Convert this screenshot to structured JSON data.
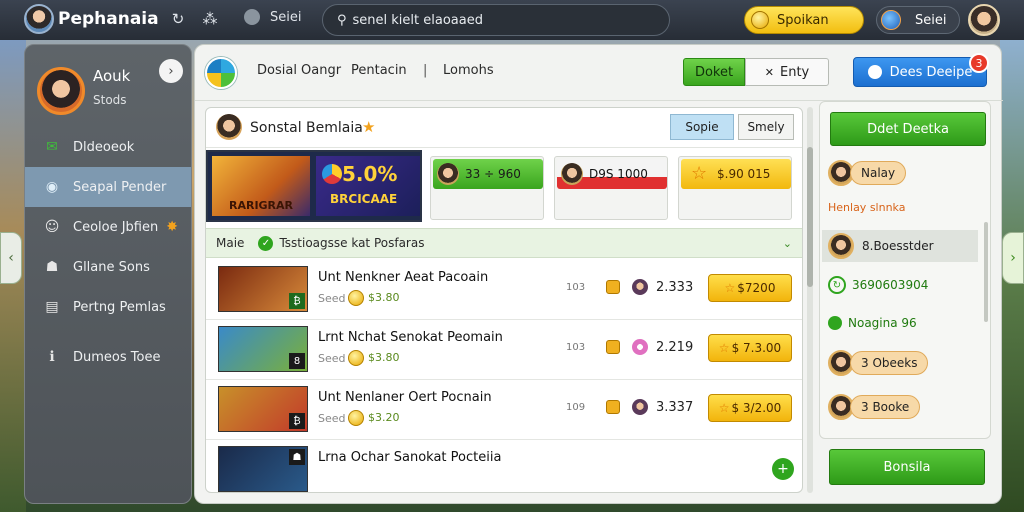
{
  "topbar": {
    "app_title": "Pephanaia",
    "icon_1": "↻",
    "icon_2": "⁂",
    "menu_label": "Seiei",
    "search_text": "senel kielt elaoaaed",
    "coins_label": "Spoikan",
    "region_label": "Seiei"
  },
  "sidebar": {
    "user_name": "Aouk",
    "user_status": "Stods",
    "collapse_icon": "›",
    "items": [
      {
        "label": "Dldeoeok",
        "icon": "envelope-icon",
        "glyph": "✉",
        "color": "#3fbf3a"
      },
      {
        "label": "Seapal Pender",
        "icon": "chat-icon",
        "glyph": "◉",
        "color": "#9ec8e8"
      },
      {
        "label": "Ceoloe Jbfien",
        "icon": "people-icon",
        "glyph": "👥",
        "badge": "✸"
      },
      {
        "label": "Gllane Sons",
        "icon": "group-icon",
        "glyph": "☗"
      },
      {
        "label": "Pertng Pemlas",
        "icon": "document-icon",
        "glyph": "▤"
      },
      {
        "label": "Dumeos Toee",
        "icon": "info-icon",
        "glyph": "ℹ"
      }
    ]
  },
  "main_header": {
    "link_1": "Dosial Oangr",
    "link_2": "Pentacin",
    "separator": "|",
    "link_3": "Lomohs",
    "tab_green": "Doket",
    "tab_white": "Enty",
    "tab_white_icon": "✕",
    "blue_button": "Dees Deeipe",
    "notification_count": "3"
  },
  "card": {
    "title": "Sonstal Bemlaia",
    "title_star": "★",
    "chip_1": "Sopie",
    "chip_2": "Smely",
    "banner": {
      "game_label": "RARIGRAR",
      "promo_value": "5.0%",
      "promo_label": "BRCICAAE"
    },
    "stats": [
      {
        "value": "33 ÷ 960",
        "style": "green"
      },
      {
        "value": "D9S 1000",
        "style": "red"
      },
      {
        "value": "$.90 015",
        "style": "yellow"
      }
    ],
    "filter": {
      "label": "Maie",
      "text": "Tsstioagsse kat Posfaras",
      "chevron": "⌄"
    },
    "offers": [
      {
        "title": "Unt Nenkner Aeat Pacoain",
        "sub": "Seed",
        "points": "$3.80",
        "num": "103",
        "count": "2.333",
        "price": "$7200",
        "badge": "₿",
        "thumb_colors": [
          "#7a2a10",
          "#d88a3a"
        ]
      },
      {
        "title": "Lrnt Nchat Senokat Peomain",
        "sub": "Seed",
        "points": "$3.80",
        "num": "103",
        "count": "2.219",
        "price": "$ 7.3.00",
        "badge": "8",
        "thumb_colors": [
          "#3a8ac8",
          "#7ab03a"
        ]
      },
      {
        "title": "Unt Nenlaner Oert Pocnain",
        "sub": "Seed",
        "points": "$3.20",
        "num": "109",
        "count": "3.337",
        "price": "$ 3/2.00",
        "badge": "₿",
        "thumb_colors": [
          "#c8902a",
          "#c23a2a"
        ]
      },
      {
        "title": "Lrna Ochar Sanokat Pocteiia",
        "sub": "",
        "points": "",
        "num": "",
        "count": "",
        "price": "",
        "badge": "☗",
        "thumb_colors": [
          "#1a2a4a",
          "#2a5a8a"
        ]
      }
    ]
  },
  "right_panel": {
    "top_button": "Ddet Deetka",
    "items": [
      {
        "label": "Nalay",
        "type": "pill-face"
      },
      {
        "label": "Henlay slnnka",
        "type": "orange-text"
      },
      {
        "label": "8.Boesstder",
        "type": "highlight-face"
      },
      {
        "label": "3690603904",
        "type": "green-circle"
      },
      {
        "label": "Noagina 96",
        "type": "green-dot"
      },
      {
        "label": "3 Obeeks",
        "type": "pill-face"
      },
      {
        "label": "3 Booke",
        "type": "pill-face"
      }
    ]
  },
  "bottom_button": "Bonsila",
  "colors": {
    "accent_green": "#3aa51e",
    "accent_blue": "#1c6fd0",
    "accent_yellow": "#f2b80e",
    "topbar_bg": "#2b313a"
  }
}
